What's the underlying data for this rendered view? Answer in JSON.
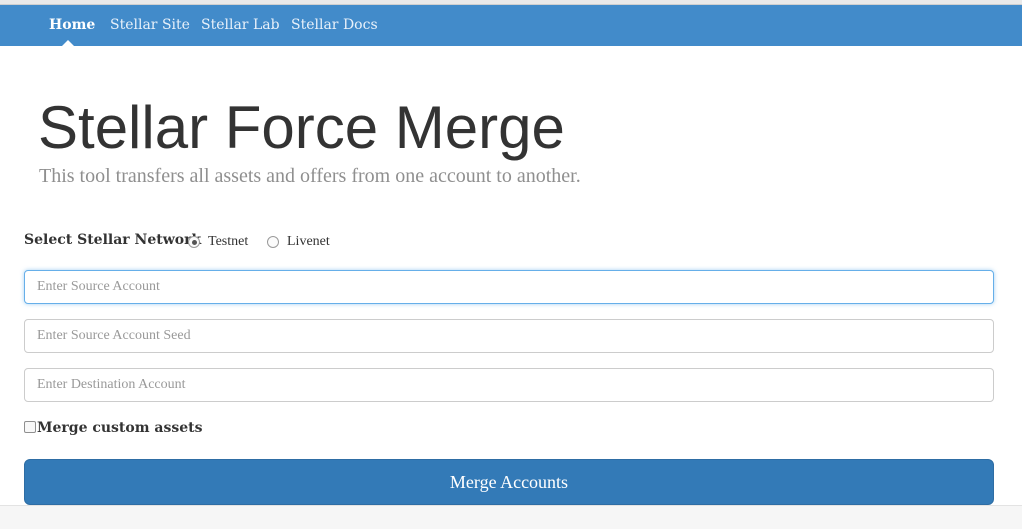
{
  "nav": {
    "items": [
      {
        "label": "Home",
        "active": true
      },
      {
        "label": "Stellar Site",
        "active": false
      },
      {
        "label": "Stellar Lab",
        "active": false
      },
      {
        "label": "Stellar Docs",
        "active": false
      }
    ]
  },
  "header": {
    "title": "Stellar Force Merge",
    "subtitle": "This tool transfers all assets and offers from one account to another."
  },
  "network": {
    "label": "Select Stellar Network",
    "options": [
      {
        "label": "Testnet",
        "selected": true
      },
      {
        "label": "Livenet",
        "selected": false
      }
    ]
  },
  "form": {
    "source_account": {
      "value": "",
      "placeholder": "Enter Source Account",
      "focused": true
    },
    "source_seed": {
      "value": "",
      "placeholder": "Enter Source Account Seed"
    },
    "destination_account": {
      "value": "",
      "placeholder": "Enter Destination Account"
    },
    "merge_custom_assets": {
      "label": "Merge custom assets",
      "checked": false
    },
    "submit_label": "Merge Accounts"
  },
  "colors": {
    "navbar": "#428bca",
    "button": "#337ab7",
    "focus_border": "#66afe9"
  }
}
